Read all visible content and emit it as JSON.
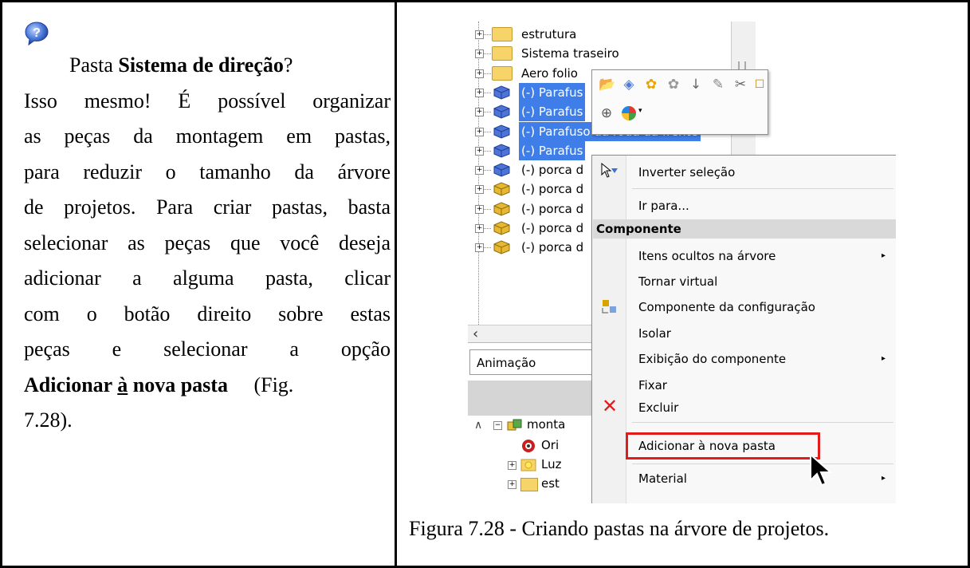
{
  "left": {
    "lines": [
      [
        "Pasta ",
        {
          "b": "Sistema de direção"
        },
        "?"
      ],
      [
        "Isso mesmo! É possível organizar"
      ],
      [
        "as peças da montagem em pastas,"
      ],
      [
        "para reduzir o tamanho da árvore"
      ],
      [
        "de projetos. Para criar pastas, basta"
      ],
      [
        "selecionar as peças que você deseja"
      ],
      [
        "adicionar a alguma pasta, clicar"
      ],
      [
        "com o botão direito sobre estas"
      ],
      [
        "peças e selecionar a opção"
      ],
      [
        "Adicionar à nova pasta (Fig."
      ],
      [
        "7.28)."
      ]
    ],
    "line1_plain": "Pasta ",
    "line1_bold": "Sistema de direção",
    "line1_end": "?",
    "line2": "Isso mesmo! É possível organizar",
    "line3": "as peças da montagem em pastas,",
    "line4": "para reduzir o tamanho da árvore",
    "line5": "de projetos. Para criar pastas, basta",
    "line6": "selecionar as peças que você deseja",
    "line7": "adicionar a alguma pasta, clicar",
    "line8": "com o botão direito sobre estas",
    "line9_a": "peças",
    "line9_b": "e",
    "line9_c": "selecionar",
    "line9_d": "a",
    "line9_e": "opção",
    "line10_bold1": "Adicionar ",
    "line10_underline": "à",
    "line10_bold2": " nova pasta",
    "line10_end": " (Fig.",
    "line11": "7.28)."
  },
  "tree": {
    "rows": [
      {
        "label": "estrutura",
        "kind": "folder"
      },
      {
        "label": "Sistema traseiro",
        "kind": "folder"
      },
      {
        "label": "Aero folio",
        "kind": "folder"
      },
      {
        "label": "(-) Parafus",
        "kind": "part-blue",
        "selected": true
      },
      {
        "label": "(-) Parafus",
        "kind": "part-blue",
        "selected": true
      },
      {
        "label": "(-) Parafuso da roda da frente",
        "kind": "part-blue",
        "selected": true
      },
      {
        "label": "(-) Parafus",
        "kind": "part-blue",
        "selected": true
      },
      {
        "label": "(-) porca d",
        "kind": "part-blue"
      },
      {
        "label": "(-) porca d",
        "kind": "part-yellow"
      },
      {
        "label": "(-) porca d",
        "kind": "part-yellow"
      },
      {
        "label": "(-) porca d",
        "kind": "part-yellow"
      },
      {
        "label": "(-) porca d",
        "kind": "part-yellow"
      }
    ],
    "anim_tab": "Animação",
    "lower_rows": [
      "monta",
      "Ori",
      "Luz",
      "est"
    ]
  },
  "menu": {
    "invert": "Inverter seleção",
    "goto": "Ir para...",
    "header": "Componente",
    "hidden": "Itens ocultos na árvore",
    "virtual": "Tornar virtual",
    "config": "Componente da configuração",
    "isolate": "Isolar",
    "display": "Exibição do componente",
    "fix": "Fixar",
    "delete": "Excluir",
    "add_folder": "Adicionar à nova pasta",
    "material": "Material"
  },
  "caption": "Figura 7.28 - Criando pastas na árvore de projetos.",
  "colors": {
    "selection": "#3f7ee8",
    "highlight_box": "#e21b1b",
    "folder": "#f7d46a"
  }
}
